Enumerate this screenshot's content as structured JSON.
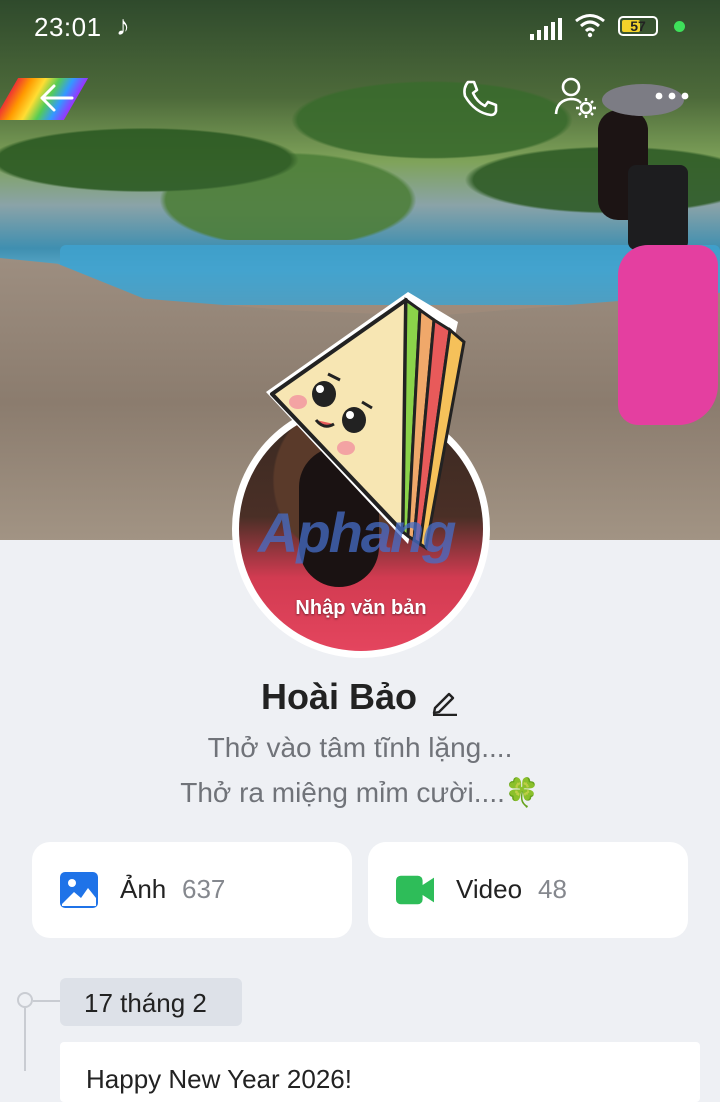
{
  "status_bar": {
    "time": "23:01",
    "battery": "57",
    "battery_level": 0.57
  },
  "nav": {
    "back_icon": "arrow-left-icon",
    "call_icon": "phone-icon",
    "settings_icon": "user-settings-icon",
    "more_icon": "more-dots-icon"
  },
  "cover": {
    "watermark": "Aphang"
  },
  "avatar": {
    "caption": "Nhập văn bản"
  },
  "profile": {
    "name": "Hoài Bảo",
    "bio_line1": "Thở vào tâm tĩnh lặng....",
    "bio_line2": "Thở ra miệng mỉm cười....🍀"
  },
  "media": {
    "photos": {
      "label": "Ảnh",
      "count": "637",
      "icon": "image-icon",
      "color": "#1f73e8"
    },
    "videos": {
      "label": "Video",
      "count": "48",
      "icon": "video-camera-icon",
      "color": "#2ebd59"
    }
  },
  "timeline": {
    "date": "17 tháng 2",
    "post_text": "Happy New Year 2026!"
  }
}
